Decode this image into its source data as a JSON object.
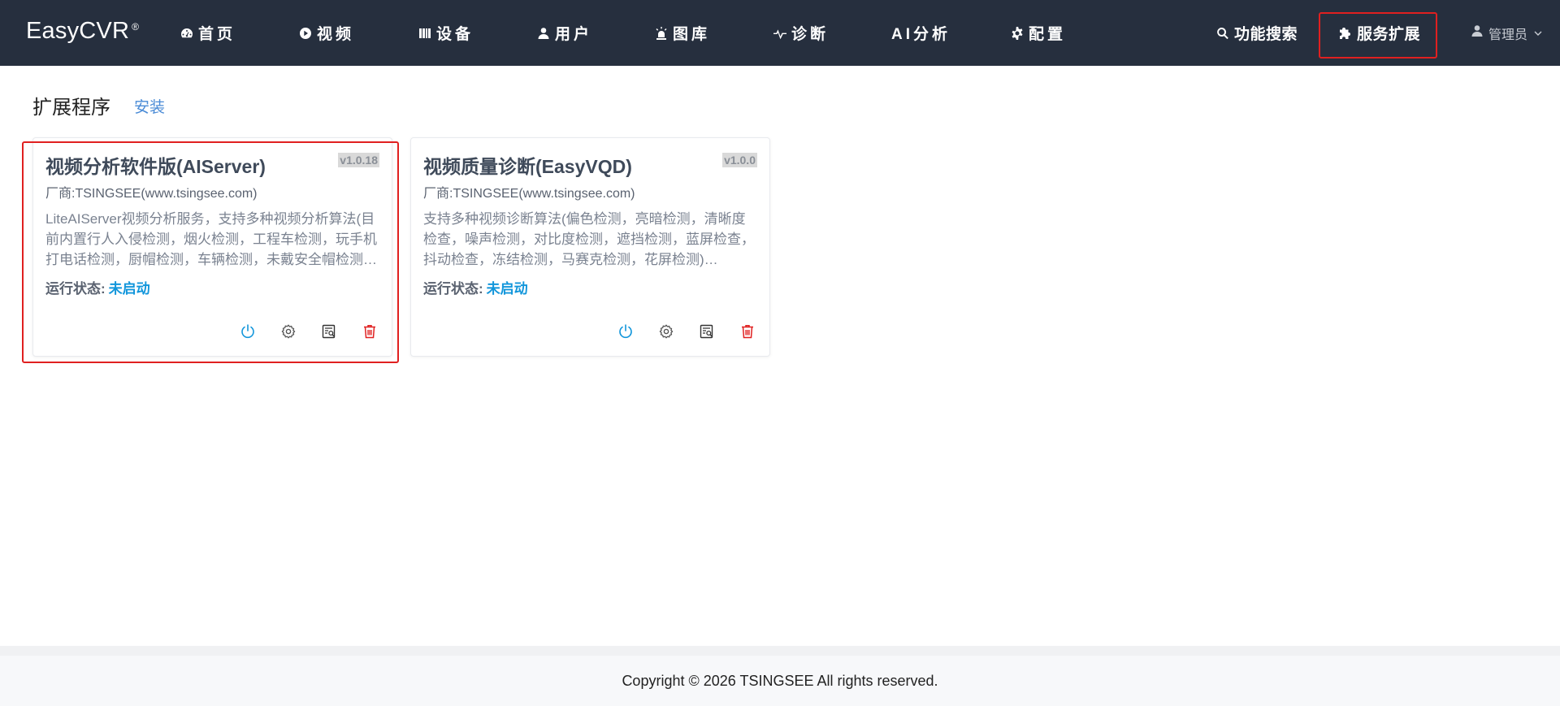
{
  "app": {
    "brand": "EasyCVR",
    "brand_mark": "®"
  },
  "nav": {
    "items": [
      {
        "label": "首页",
        "icon": "dashboard-icon"
      },
      {
        "label": "视频",
        "icon": "play-circle-icon"
      },
      {
        "label": "设备",
        "icon": "device-icon"
      },
      {
        "label": "用户",
        "icon": "user-icon"
      },
      {
        "label": "图库",
        "icon": "alarm-icon"
      },
      {
        "label": "诊断",
        "icon": "pulse-icon"
      },
      {
        "label": "AI分析",
        "icon": ""
      },
      {
        "label": "配置",
        "icon": "gear-icon"
      }
    ],
    "search_label": "功能搜索",
    "extensions_label": "服务扩展",
    "user_label": "管理员"
  },
  "page": {
    "title": "扩展程序",
    "install_label": "安装"
  },
  "cards": [
    {
      "title": "视频分析软件版(AIServer)",
      "version": "v1.0.18",
      "vendor": "厂商:TSINGSEE(www.tsingsee.com)",
      "description": "LiteAIServer视频分析服务，支持多种视频分析算法(目前内置行人入侵检测，烟火检测，工程车检测，玩手机打电话检测，厨帽检测，车辆检测，未戴安全帽检测…",
      "status_label": "运行状态:",
      "status_value": "未启动"
    },
    {
      "title": "视频质量诊断(EasyVQD)",
      "version": "v1.0.0",
      "vendor": "厂商:TSINGSEE(www.tsingsee.com)",
      "description": "支持多种视频诊断算法(偏色检测，亮暗检测，清晰度检查，噪声检测，对比度检测，遮挡检测，蓝屏检查，抖动检查，冻结检测，马赛克检测，花屏检测)…",
      "status_label": "运行状态:",
      "status_value": "未启动"
    }
  ],
  "footer": {
    "copyright": "Copyright © 2026 TSINGSEE All rights reserved."
  },
  "colors": {
    "navbar": "#262f3e",
    "highlight": "#e02020",
    "status": "#1296db",
    "delete": "#e02020",
    "link": "#4a8bd6"
  }
}
